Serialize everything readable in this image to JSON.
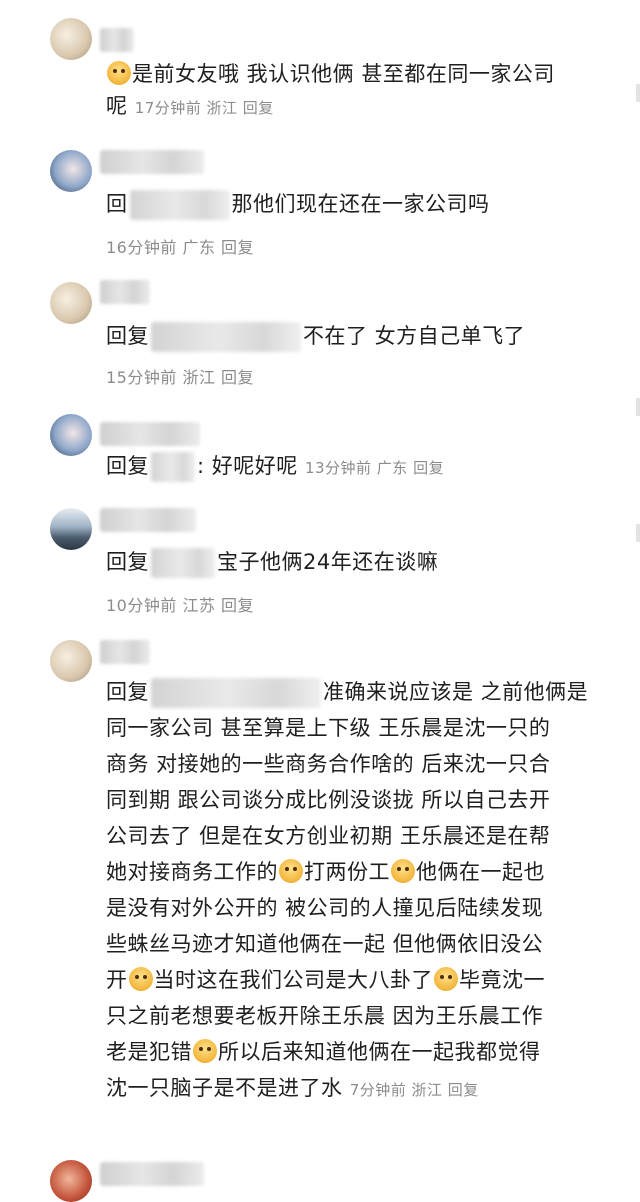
{
  "comments": [
    {
      "text": "是前女友哦 我认识他俩 甚至都在同一家公司",
      "text2": "呢",
      "meta": "17分钟前 浙江 回复"
    },
    {
      "prefix": "回",
      "text": "那他们现在还在一家公司吗",
      "meta": "16分钟前 广东 回复"
    },
    {
      "prefix": "回复",
      "text": "不在了 女方自己单飞了",
      "meta": "15分钟前 浙江 回复"
    },
    {
      "prefix": "回复",
      "text": ": 好呢好呢",
      "meta": "13分钟前 广东 回复"
    },
    {
      "prefix": "回复",
      "text": "宝子他俩24年还在谈嘛",
      "meta": "10分钟前 江苏 回复"
    },
    {
      "prefix": "回复",
      "lines": [
        "准确来说应该是 之前他俩是",
        "同一家公司 甚至算是上下级 王乐晨是沈一只的",
        "商务 对接她的一些商务合作啥的 后来沈一只合",
        "同到期 跟公司谈分成比例没谈拢 所以自己去开",
        "公司去了 但是在女方创业初期 王乐晨还是在帮",
        "她对接商务工作的",
        "打两份工",
        "他俩在一起也",
        "是没有对外公开的 被公司的人撞见后陆续发现",
        "些蛛丝马迹才知道他俩在一起 但他俩依旧没公",
        "开",
        "当时这在我们公司是大八卦了",
        "毕竟沈一",
        "只之前老想要老板开除王乐晨 因为王乐晨工作",
        "老是犯错",
        "所以后来知道他俩在一起我都觉得",
        "沈一只脑子是不是进了水"
      ],
      "meta": "7分钟前 浙江 回复"
    }
  ],
  "icons": {
    "emoji": "smiling-dog-emoji",
    "avatar_types": [
      "dog-avatar",
      "girl-avatar",
      "dog-avatar",
      "girl-avatar",
      "mountain-avatar",
      "dog-avatar",
      "red-avatar"
    ]
  },
  "colors": {
    "text": "#1f1f1f",
    "meta": "#8c8c8c",
    "background": "#ffffff"
  }
}
